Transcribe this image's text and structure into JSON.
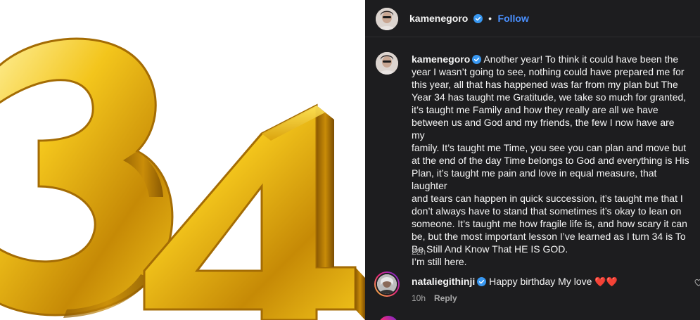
{
  "post": {
    "username": "kamenegoro",
    "separator": "•",
    "follow_label": "Follow",
    "image_text": "34"
  },
  "caption": {
    "username": "kamenegoro",
    "lines": [
      "Another year! To think it could have been the",
      "year I wasn’t going to see, nothing could have prepared me for",
      "this year, all that has happened was far from my plan but The",
      "Year 34 has taught me Gratitude, we take so much for granted,",
      "it’s taught me Family and how they really are all we have",
      "between us and God and my friends, the few I now have are my",
      "family. It’s taught me Time, you see you can plan and move but",
      "at the end of the day Time belongs to God and everything is His",
      "Plan, it’s taught me pain and love in equal measure, that laughter",
      "and tears can happen in quick succession, it’s taught me that I",
      "don’t always have to stand that sometimes it’s okay to lean on",
      "someone. It’s taught me how fragile life is, and how scary it can",
      "be, but the most important lesson I’ve learned as I turn 34 is To",
      "Be Still And Know That HE IS GOD.",
      "I’m still here."
    ],
    "time": "22h"
  },
  "comments": [
    {
      "username": "nataliegithinji",
      "text": "Happy birthday My love",
      "hearts": "❤️❤️",
      "time": "10h",
      "reply_label": "Reply"
    }
  ],
  "colors": {
    "panel_bg": "#1d1d1f",
    "accent_blue": "#4a90ff",
    "verified_blue": "#3897f0",
    "gold": "#e8b820"
  }
}
